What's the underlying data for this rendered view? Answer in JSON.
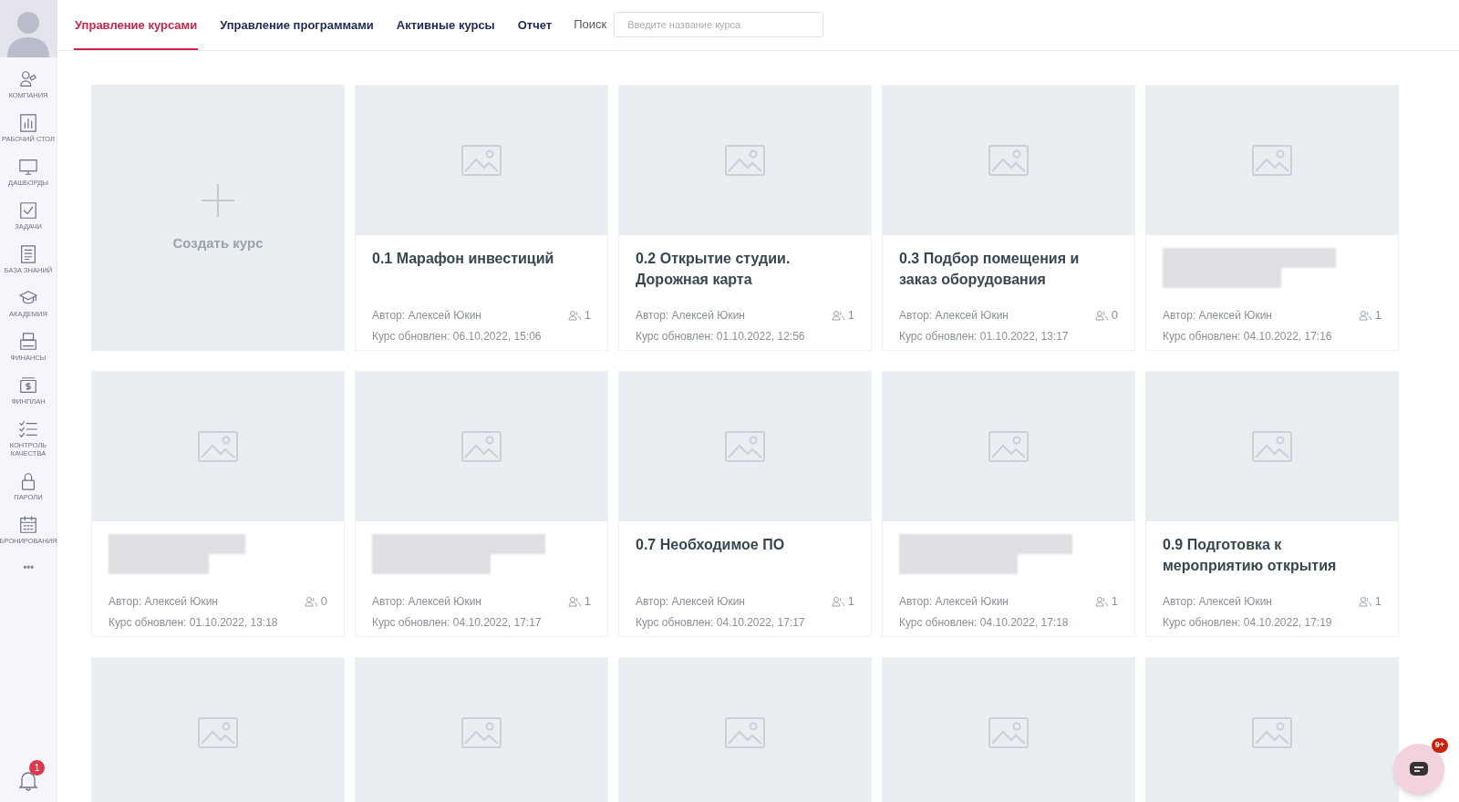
{
  "sidebar": {
    "items": [
      {
        "label": "КОМПАНИЯ"
      },
      {
        "label": "РАБОЧИЙ СТОЛ"
      },
      {
        "label": "ДАШБОРДЫ"
      },
      {
        "label": "ЗАДАЧИ"
      },
      {
        "label": "БАЗА ЗНАНИЙ"
      },
      {
        "label": "АКАДЕМИЯ"
      },
      {
        "label": "ФИНАНСЫ"
      },
      {
        "label": "ФИНПЛАН"
      },
      {
        "label": "КОНТРОЛЬ КАЧЕСТВА"
      },
      {
        "label": "ПАРОЛИ"
      },
      {
        "label": "БРОНИРОВАНИЯ"
      }
    ],
    "more": "•••",
    "notifications": "1"
  },
  "tabs": [
    {
      "label": "Управление курсами",
      "selected": true
    },
    {
      "label": "Управление программами",
      "selected": false
    },
    {
      "label": "Активные курсы",
      "selected": false
    },
    {
      "label": "Отчет",
      "selected": false
    }
  ],
  "search": {
    "label": "Поиск",
    "placeholder": "Введите название курса"
  },
  "cards": [
    {
      "kind": "create",
      "label": "Создать курс"
    },
    {
      "kind": "course",
      "title": "0.1 Марафон инвестиций",
      "author": "Автор: Алексей Юкин",
      "members": "1",
      "updated": "Курс обновлен: 06.10.2022, 15:06"
    },
    {
      "kind": "course",
      "title": "0.2 Открытие студии. Дорожная карта",
      "author": "Автор: Алексей Юкин",
      "members": "1",
      "updated": "Курс обновлен: 01.10.2022, 12:56"
    },
    {
      "kind": "course",
      "title": "0.3 Подбор помещения и заказ оборудования",
      "author": "Автор: Алексей Юкин",
      "members": "0",
      "updated": "Курс обновлен: 01.10.2022, 13:17"
    },
    {
      "kind": "blurred",
      "author": "Автор: Алексей Юкин",
      "members": "1",
      "updated": "Курс обновлен: 04.10.2022, 17:16"
    },
    {
      "kind": "blurred",
      "author": "Автор: Алексей Юкин",
      "members": "0",
      "updated": "Курс обновлен: 01.10.2022, 13:18"
    },
    {
      "kind": "blurred",
      "author": "Автор: Алексей Юкин",
      "members": "1",
      "updated": "Курс обновлен: 04.10.2022, 17:17"
    },
    {
      "kind": "course",
      "title": "0.7 Необходимое ПО",
      "author": "Автор: Алексей Юкин",
      "members": "1",
      "updated": "Курс обновлен: 04.10.2022, 17:17"
    },
    {
      "kind": "blurred",
      "author": "Автор: Алексей Юкин",
      "members": "1",
      "updated": "Курс обновлен: 04.10.2022, 17:18"
    },
    {
      "kind": "course",
      "title": "0.9 Подготовка к мероприятию открытия",
      "author": "Автор: Алексей Юкин",
      "members": "1",
      "updated": "Курс обновлен: 04.10.2022, 17:19"
    },
    {
      "kind": "cut"
    },
    {
      "kind": "cut"
    },
    {
      "kind": "cut"
    },
    {
      "kind": "cut"
    },
    {
      "kind": "cut"
    }
  ],
  "chat": {
    "badge": "9+"
  }
}
